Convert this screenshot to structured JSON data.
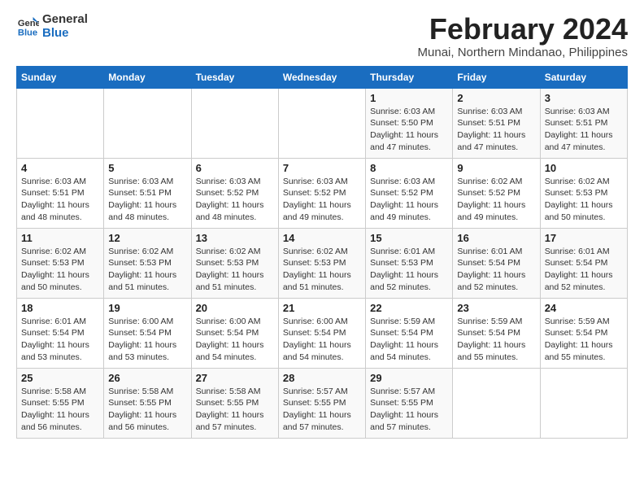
{
  "logo": {
    "line1": "General",
    "line2": "Blue"
  },
  "title": "February 2024",
  "subtitle": "Munai, Northern Mindanao, Philippines",
  "weekdays": [
    "Sunday",
    "Monday",
    "Tuesday",
    "Wednesday",
    "Thursday",
    "Friday",
    "Saturday"
  ],
  "weeks": [
    [
      {
        "num": "",
        "info": ""
      },
      {
        "num": "",
        "info": ""
      },
      {
        "num": "",
        "info": ""
      },
      {
        "num": "",
        "info": ""
      },
      {
        "num": "1",
        "info": "Sunrise: 6:03 AM\nSunset: 5:50 PM\nDaylight: 11 hours and 47 minutes."
      },
      {
        "num": "2",
        "info": "Sunrise: 6:03 AM\nSunset: 5:51 PM\nDaylight: 11 hours and 47 minutes."
      },
      {
        "num": "3",
        "info": "Sunrise: 6:03 AM\nSunset: 5:51 PM\nDaylight: 11 hours and 47 minutes."
      }
    ],
    [
      {
        "num": "4",
        "info": "Sunrise: 6:03 AM\nSunset: 5:51 PM\nDaylight: 11 hours and 48 minutes."
      },
      {
        "num": "5",
        "info": "Sunrise: 6:03 AM\nSunset: 5:51 PM\nDaylight: 11 hours and 48 minutes."
      },
      {
        "num": "6",
        "info": "Sunrise: 6:03 AM\nSunset: 5:52 PM\nDaylight: 11 hours and 48 minutes."
      },
      {
        "num": "7",
        "info": "Sunrise: 6:03 AM\nSunset: 5:52 PM\nDaylight: 11 hours and 49 minutes."
      },
      {
        "num": "8",
        "info": "Sunrise: 6:03 AM\nSunset: 5:52 PM\nDaylight: 11 hours and 49 minutes."
      },
      {
        "num": "9",
        "info": "Sunrise: 6:02 AM\nSunset: 5:52 PM\nDaylight: 11 hours and 49 minutes."
      },
      {
        "num": "10",
        "info": "Sunrise: 6:02 AM\nSunset: 5:53 PM\nDaylight: 11 hours and 50 minutes."
      }
    ],
    [
      {
        "num": "11",
        "info": "Sunrise: 6:02 AM\nSunset: 5:53 PM\nDaylight: 11 hours and 50 minutes."
      },
      {
        "num": "12",
        "info": "Sunrise: 6:02 AM\nSunset: 5:53 PM\nDaylight: 11 hours and 51 minutes."
      },
      {
        "num": "13",
        "info": "Sunrise: 6:02 AM\nSunset: 5:53 PM\nDaylight: 11 hours and 51 minutes."
      },
      {
        "num": "14",
        "info": "Sunrise: 6:02 AM\nSunset: 5:53 PM\nDaylight: 11 hours and 51 minutes."
      },
      {
        "num": "15",
        "info": "Sunrise: 6:01 AM\nSunset: 5:53 PM\nDaylight: 11 hours and 52 minutes."
      },
      {
        "num": "16",
        "info": "Sunrise: 6:01 AM\nSunset: 5:54 PM\nDaylight: 11 hours and 52 minutes."
      },
      {
        "num": "17",
        "info": "Sunrise: 6:01 AM\nSunset: 5:54 PM\nDaylight: 11 hours and 52 minutes."
      }
    ],
    [
      {
        "num": "18",
        "info": "Sunrise: 6:01 AM\nSunset: 5:54 PM\nDaylight: 11 hours and 53 minutes."
      },
      {
        "num": "19",
        "info": "Sunrise: 6:00 AM\nSunset: 5:54 PM\nDaylight: 11 hours and 53 minutes."
      },
      {
        "num": "20",
        "info": "Sunrise: 6:00 AM\nSunset: 5:54 PM\nDaylight: 11 hours and 54 minutes."
      },
      {
        "num": "21",
        "info": "Sunrise: 6:00 AM\nSunset: 5:54 PM\nDaylight: 11 hours and 54 minutes."
      },
      {
        "num": "22",
        "info": "Sunrise: 5:59 AM\nSunset: 5:54 PM\nDaylight: 11 hours and 54 minutes."
      },
      {
        "num": "23",
        "info": "Sunrise: 5:59 AM\nSunset: 5:54 PM\nDaylight: 11 hours and 55 minutes."
      },
      {
        "num": "24",
        "info": "Sunrise: 5:59 AM\nSunset: 5:54 PM\nDaylight: 11 hours and 55 minutes."
      }
    ],
    [
      {
        "num": "25",
        "info": "Sunrise: 5:58 AM\nSunset: 5:55 PM\nDaylight: 11 hours and 56 minutes."
      },
      {
        "num": "26",
        "info": "Sunrise: 5:58 AM\nSunset: 5:55 PM\nDaylight: 11 hours and 56 minutes."
      },
      {
        "num": "27",
        "info": "Sunrise: 5:58 AM\nSunset: 5:55 PM\nDaylight: 11 hours and 57 minutes."
      },
      {
        "num": "28",
        "info": "Sunrise: 5:57 AM\nSunset: 5:55 PM\nDaylight: 11 hours and 57 minutes."
      },
      {
        "num": "29",
        "info": "Sunrise: 5:57 AM\nSunset: 5:55 PM\nDaylight: 11 hours and 57 minutes."
      },
      {
        "num": "",
        "info": ""
      },
      {
        "num": "",
        "info": ""
      }
    ]
  ]
}
